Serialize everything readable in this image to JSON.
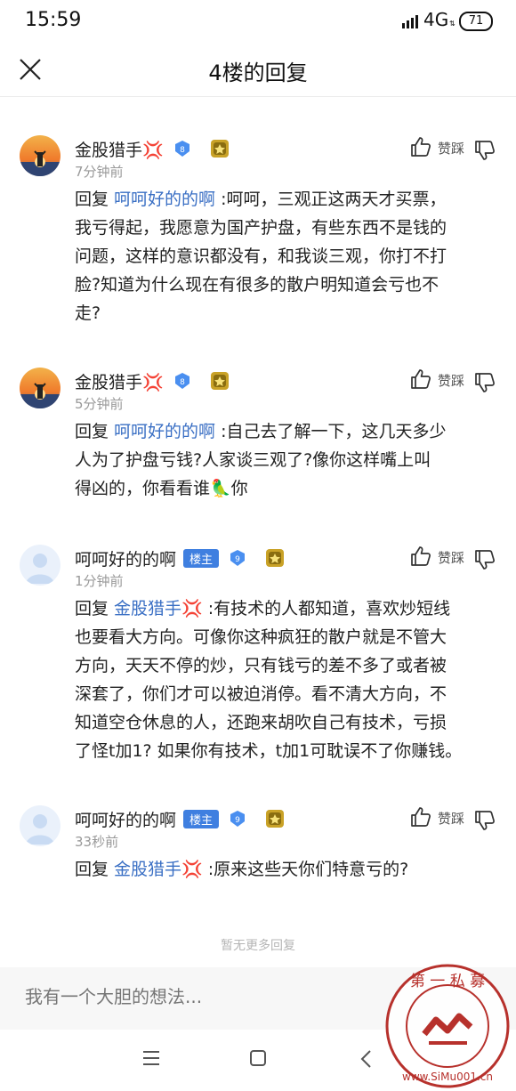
{
  "status": {
    "time": "15:59",
    "network": "4G",
    "battery": "71"
  },
  "header": {
    "title": "4楼的回复"
  },
  "comments": [
    {
      "user": "金股猎手💢",
      "level": "8",
      "time": "7分钟前",
      "is_host": false,
      "reply_prefix": "回复",
      "reply_to": "呵呵好的的啊",
      "lines": [
        ":呵呵，三观正这两天才买票，",
        "我亏得起，我愿意为国产护盘，有些东西不是钱的",
        "问题，这样的意识都没有，和我谈三观，你打不打",
        "脸?知道为什么现在有很多的散户明知道会亏也不",
        "走?"
      ]
    },
    {
      "user": "金股猎手💢",
      "level": "8",
      "time": "5分钟前",
      "is_host": false,
      "reply_prefix": "回复",
      "reply_to": "呵呵好的的啊",
      "lines": [
        ":自己去了解一下，这几天多少",
        "人为了护盘亏钱?人家谈三观了?像你这样嘴上叫",
        "得凶的，你看看谁🦜你"
      ]
    },
    {
      "user": "呵呵好的的啊",
      "level": "9",
      "time": "1分钟前",
      "is_host": true,
      "host_label": "楼主",
      "reply_prefix": "回复",
      "reply_to": "金股猎手💢",
      "lines": [
        ":有技术的人都知道，喜欢炒短线",
        "也要看大方向。可像你这种疯狂的散户就是不管大",
        "方向，天天不停的炒，只有钱亏的差不多了或者被",
        "深套了，你们才可以被迫消停。看不清大方向，不",
        "知道空仓休息的人，还跑来胡吹自己有技术，亏损",
        "了怪t加1? 如果你有技术，t加1可耽误不了你赚钱。"
      ]
    },
    {
      "user": "呵呵好的的啊",
      "level": "9",
      "time": "33秒前",
      "is_host": true,
      "host_label": "楼主",
      "reply_prefix": "回复",
      "reply_to": "金股猎手💢",
      "lines": [
        ":原来这些天你们特意亏的?"
      ]
    }
  ],
  "vote_label": "赞踩",
  "footer": {
    "no_more": "暂无更多回复",
    "input_placeholder": "我有一个大胆的想法..."
  },
  "watermark": {
    "text": "第一私募 www.SiMu001.cn"
  }
}
